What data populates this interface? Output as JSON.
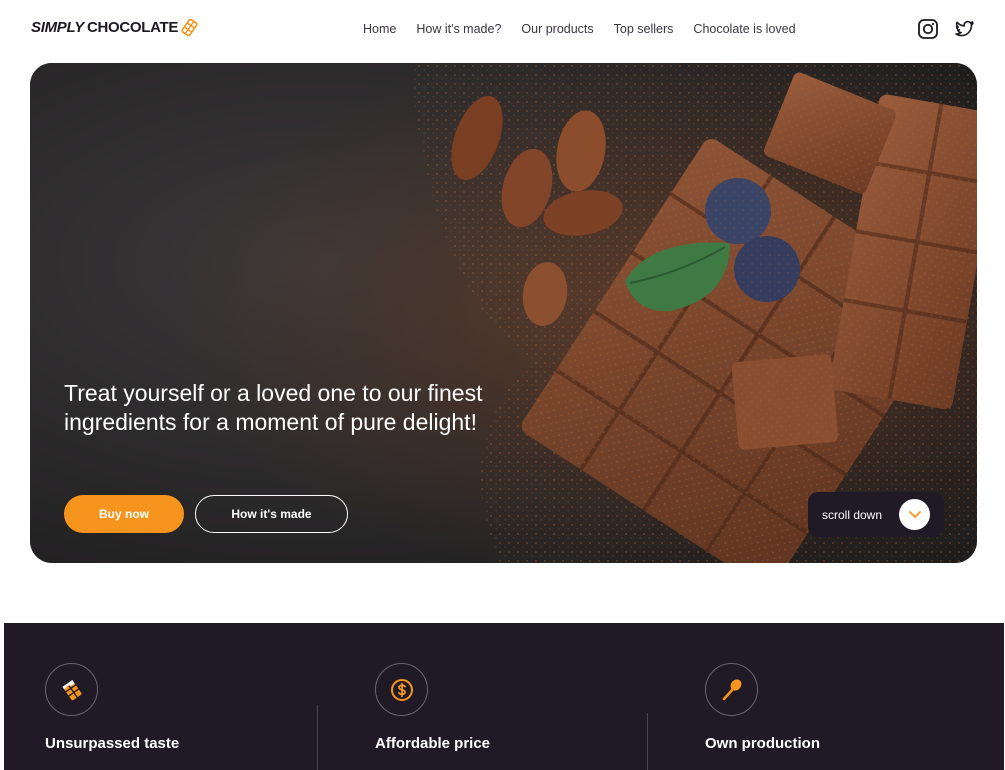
{
  "brand": {
    "name_italic": "SIMPLY",
    "name_bold": "CHOCOLATE",
    "icon": "chocolate-bar-icon",
    "accent_color": "#f7941d"
  },
  "nav": {
    "items": [
      {
        "label": "Home"
      },
      {
        "label": "How it's made?"
      },
      {
        "label": "Our products"
      },
      {
        "label": "Top sellers"
      },
      {
        "label": "Chocolate is loved"
      }
    ]
  },
  "social": [
    {
      "icon": "instagram-icon"
    },
    {
      "icon": "twitter-icon"
    }
  ],
  "hero": {
    "title": "Treat yourself or a loved one to our finest ingredients for a moment of pure delight!",
    "buy_label": "Buy now",
    "how_label": "How it's made",
    "scroll_label": "scroll down",
    "scroll_icon": "chevron-down-icon"
  },
  "features": [
    {
      "title": "Unsurpassed taste",
      "icon": "chocolate-piece-icon"
    },
    {
      "title": "Affordable price",
      "icon": "dollar-coin-icon"
    },
    {
      "title": "Own production",
      "icon": "spoon-icon"
    }
  ]
}
